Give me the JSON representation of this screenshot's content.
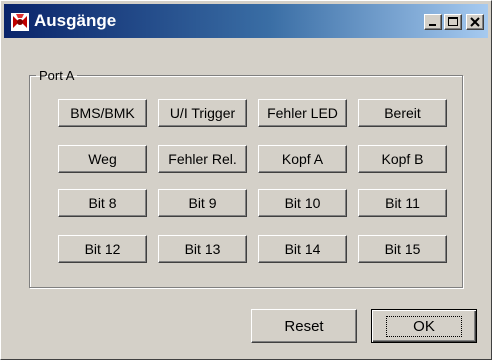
{
  "window": {
    "title": "Ausgänge"
  },
  "groupbox": {
    "label": "Port A"
  },
  "port_buttons": [
    {
      "label": "BMS/BMK"
    },
    {
      "label": "U/I Trigger"
    },
    {
      "label": "Fehler LED"
    },
    {
      "label": "Bereit"
    },
    {
      "label": "Weg"
    },
    {
      "label": "Fehler Rel."
    },
    {
      "label": "Kopf A"
    },
    {
      "label": "Kopf B"
    },
    {
      "label": "Bit 8"
    },
    {
      "label": "Bit 9"
    },
    {
      "label": "Bit 10"
    },
    {
      "label": "Bit 11"
    },
    {
      "label": "Bit 12"
    },
    {
      "label": "Bit 13"
    },
    {
      "label": "Bit 14"
    },
    {
      "label": "Bit 15"
    }
  ],
  "footer": {
    "reset_label": "Reset",
    "ok_label": "OK"
  },
  "icons": {
    "app": "app-icon",
    "minimize": "minimize-icon",
    "maximize": "maximize-icon",
    "close": "close-icon"
  }
}
